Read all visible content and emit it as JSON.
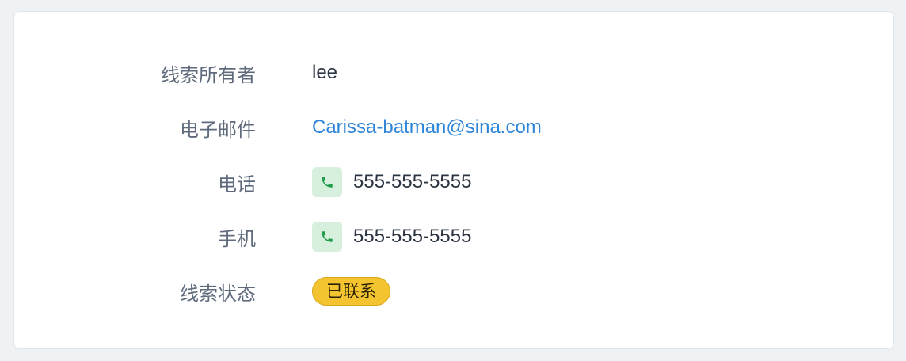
{
  "details": {
    "owner": {
      "label": "线索所有者",
      "value": "lee"
    },
    "email": {
      "label": "电子邮件",
      "value": "Carissa-batman@sina.com"
    },
    "phone": {
      "label": "电话",
      "value": "555-555-5555",
      "icon": "phone-icon"
    },
    "mobile": {
      "label": "手机",
      "value": "555-555-5555",
      "icon": "phone-icon"
    },
    "status": {
      "label": "线索状态",
      "value": "已联系",
      "color": "#f4c430"
    }
  },
  "colors": {
    "background": "#eef2f5",
    "card": "#ffffff",
    "label": "#5f6b7c",
    "link": "#2f86d8",
    "phone_bg": "#d7f0dd",
    "phone_icon": "#1f9d4a"
  }
}
